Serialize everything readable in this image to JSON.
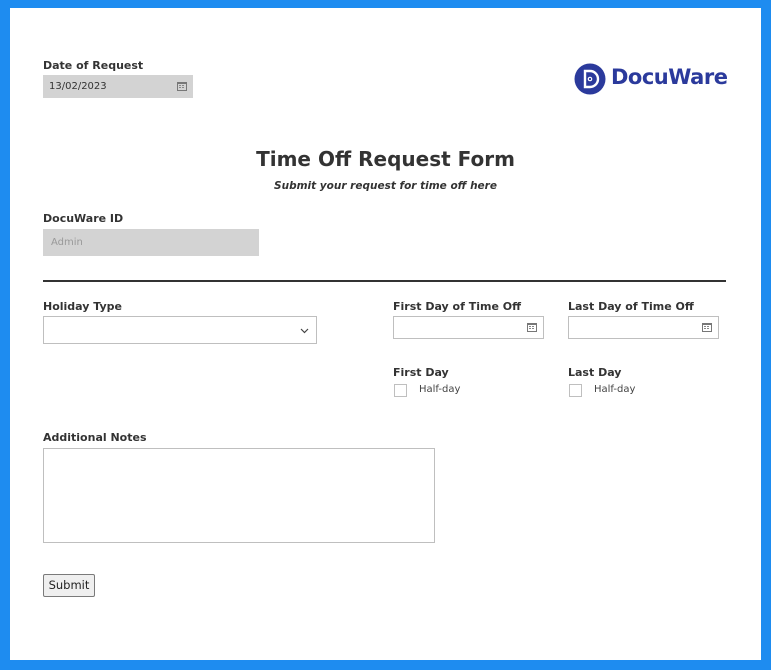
{
  "logo": {
    "brand_name": "DocuWare",
    "brand_color": "#2b3a9c"
  },
  "date_of_request": {
    "label": "Date of Request",
    "value": "13/02/2023"
  },
  "form": {
    "title": "Time Off Request Form",
    "subtitle": "Submit your request for time off here"
  },
  "docuware_id": {
    "label": "DocuWare ID",
    "placeholder": "Admin"
  },
  "holiday_type": {
    "label": "Holiday Type",
    "value": ""
  },
  "first_day_off": {
    "label": "First Day of Time Off",
    "value": ""
  },
  "last_day_off": {
    "label": "Last Day of Time Off",
    "value": ""
  },
  "first_day": {
    "label": "First Day",
    "checkbox_label": "Half-day",
    "checked": false
  },
  "last_day": {
    "label": "Last Day",
    "checkbox_label": "Half-day",
    "checked": false
  },
  "notes": {
    "label": "Additional Notes",
    "value": ""
  },
  "submit": {
    "label": "Submit"
  },
  "colors": {
    "frame": "#1e8cf0",
    "readonly_fill": "#d3d3d3",
    "divider": "#333333"
  }
}
